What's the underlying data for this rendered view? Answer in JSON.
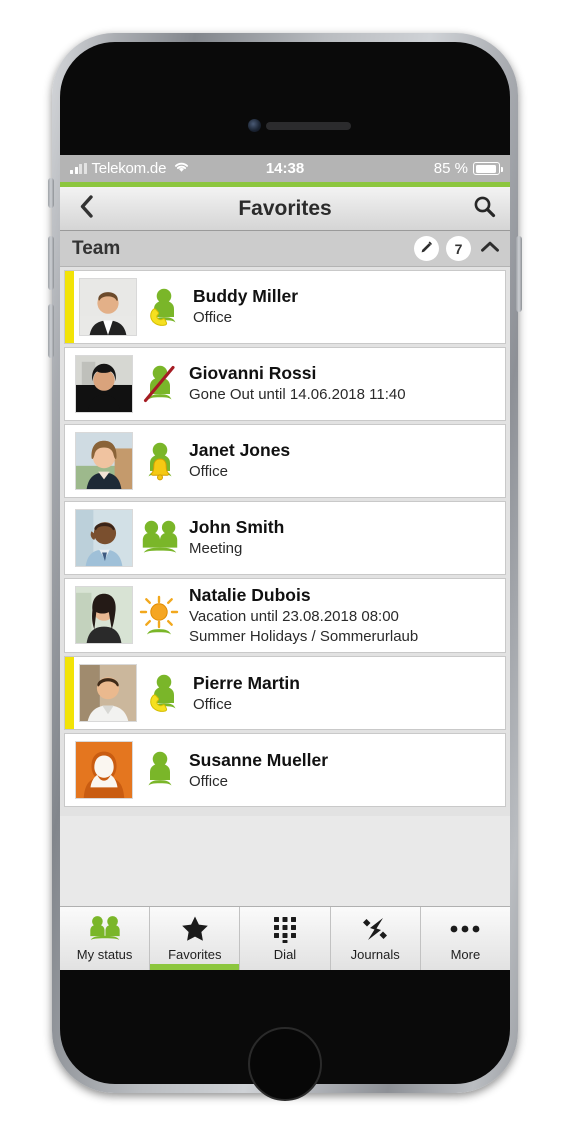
{
  "status_bar": {
    "carrier": "Telekom.de",
    "signal_icon": "signal-bars-icon",
    "wifi_icon": "wifi-icon",
    "time": "14:38",
    "battery_percent": "85 %",
    "battery_icon": "battery-icon"
  },
  "nav_bar": {
    "back_icon": "chevron-left-icon",
    "title": "Favorites",
    "search_icon": "search-icon"
  },
  "group": {
    "title": "Team",
    "edit_icon": "pencil-icon",
    "count": "7",
    "collapse_icon": "chevron-up-icon"
  },
  "contacts": [
    {
      "name": "Buddy Miller",
      "status": "Office",
      "status2": "",
      "presence_icon": "person-on-phone-icon",
      "accent": "#f2e307",
      "avatar": "photo-man-suit"
    },
    {
      "name": "Giovanni Rossi",
      "status": "Gone Out until 14.06.2018 11:40",
      "status2": "",
      "presence_icon": "person-unavailable-icon",
      "accent": "none",
      "avatar": "photo-woman-dark"
    },
    {
      "name": "Janet Jones",
      "status": "Office",
      "status2": "",
      "presence_icon": "person-bell-icon",
      "accent": "none",
      "avatar": "photo-woman-smiling"
    },
    {
      "name": "John Smith",
      "status": "Meeting",
      "status2": "",
      "presence_icon": "two-people-meeting-icon",
      "accent": "none",
      "avatar": "photo-man-phone"
    },
    {
      "name": "Natalie Dubois",
      "status": "Vacation until 23.08.2018 08:00",
      "status2": "Summer Holidays / Sommerurlaub",
      "presence_icon": "sun-vacation-icon",
      "accent": "none",
      "avatar": "photo-woman-dark-hair"
    },
    {
      "name": "Pierre Martin",
      "status": "Office",
      "status2": "",
      "presence_icon": "person-on-phone-icon",
      "accent": "#f2e307",
      "avatar": "photo-man-smiling"
    },
    {
      "name": "Susanne Mueller",
      "status": "Office",
      "status2": "",
      "presence_icon": "person-available-icon",
      "accent": "none",
      "avatar": "placeholder-woman-orange"
    }
  ],
  "tabs": [
    {
      "label": "My status",
      "icon": "two-people-icon",
      "active": false
    },
    {
      "label": "Favorites",
      "icon": "star-icon",
      "active": true
    },
    {
      "label": "Dial",
      "icon": "keypad-icon",
      "active": false
    },
    {
      "label": "Journals",
      "icon": "arrows-icon",
      "active": false
    },
    {
      "label": "More",
      "icon": "ellipsis-icon",
      "active": false
    }
  ],
  "colors": {
    "accent_green": "#8cc63e",
    "presence_green": "#7ab629",
    "accent_yellow": "#f2e307",
    "unavailable_red": "#a51c23",
    "sun_orange": "#f5a623",
    "avatar_orange": "#e4761f"
  }
}
